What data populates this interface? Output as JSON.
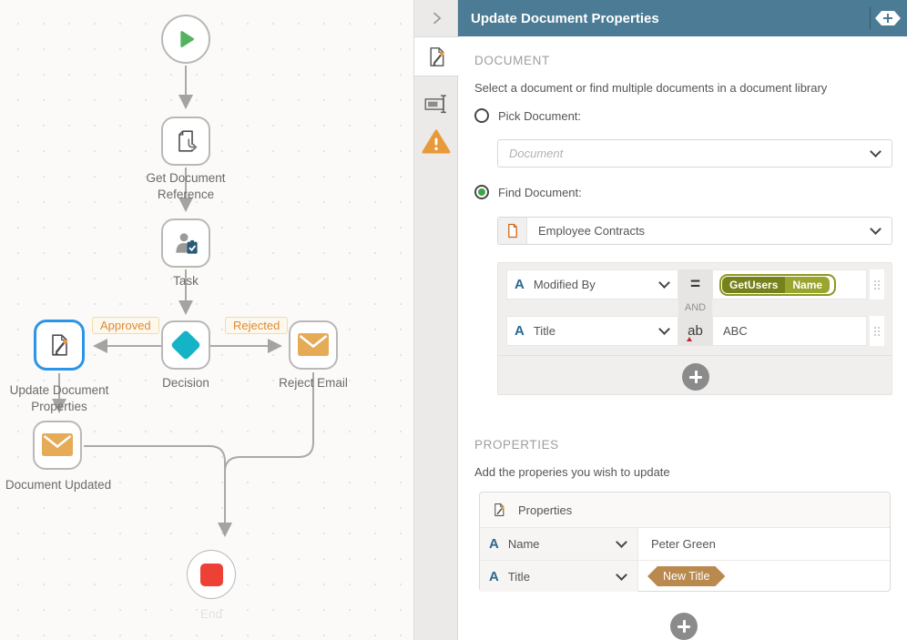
{
  "canvas": {
    "labels": {
      "get_document_reference": "Get Document Reference",
      "task": "Task",
      "decision": "Decision",
      "update_document_properties": "Update Document Properties",
      "reject_email": "Reject Email",
      "document_updated": "Document Updated",
      "end": "End",
      "approved": "Approved",
      "rejected": "Rejected"
    }
  },
  "panel": {
    "title": "Update Document Properties",
    "glyphs": {
      "text_field": "A"
    },
    "document": {
      "heading": "DOCUMENT",
      "description": "Select a document or find multiple documents in a document library",
      "pick_document_label": "Pick Document:",
      "pick_document_placeholder": "Document",
      "find_document_label": "Find Document:",
      "library_value": "Employee Contracts",
      "filter": {
        "conjunction": "AND",
        "rows": [
          {
            "field": "Modified By",
            "operator": "=",
            "value_tokens": [
              "GetUsers",
              "Name"
            ]
          },
          {
            "field": "Title",
            "operator": "ab",
            "value": "ABC"
          }
        ]
      }
    },
    "properties": {
      "heading": "PROPERTIES",
      "description": "Add the properies you wish to update",
      "box_title": "Properties",
      "rows": [
        {
          "field": "Name",
          "value": "Peter Green"
        },
        {
          "field": "Title",
          "value": "New Title"
        }
      ]
    },
    "colors": {
      "header_bar": "#4b7b95",
      "selected_node_border": "#2b95e8",
      "start_green": "#55b25f",
      "stop_red": "#ee4136",
      "decision_teal": "#14b4c6",
      "email_orange": "#e5ab57",
      "warning_orange": "#e8993a",
      "branch_label_text": "#df8a31",
      "reference_tag_dark": "#75811b",
      "reference_tag_light": "#9aa52e",
      "value_tag_tan": "#b9894d",
      "field_type_blue": "#29698e"
    }
  }
}
